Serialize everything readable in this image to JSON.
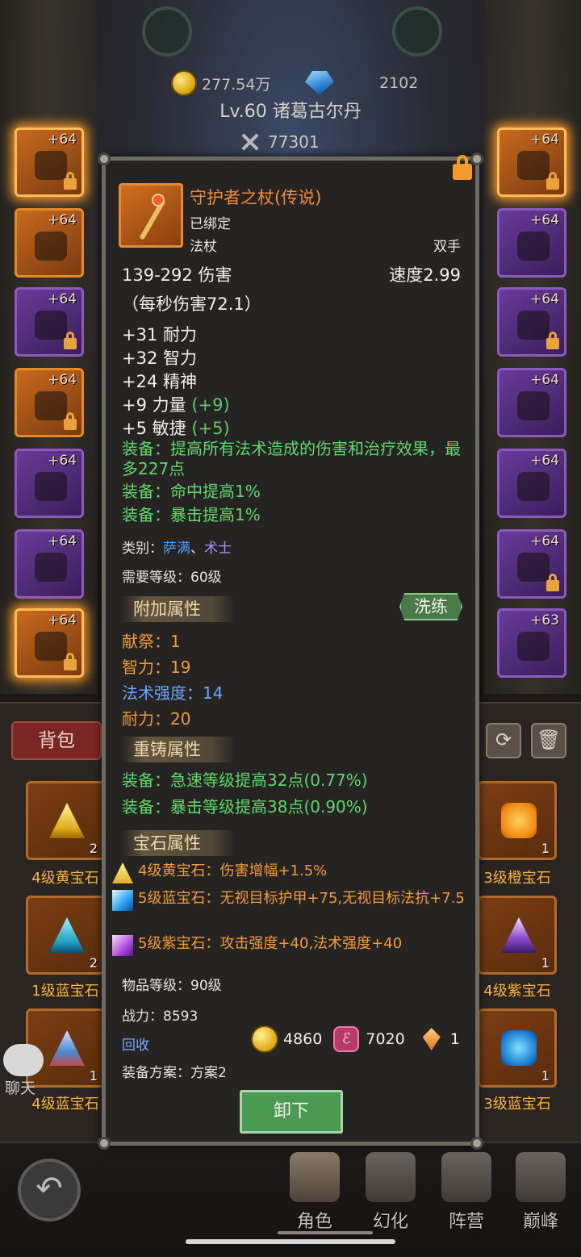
{
  "header": {
    "gold": "277.54万",
    "gems": "2102",
    "hero_name": "Lv.60 诸葛古尔丹",
    "combat_power": "77301"
  },
  "equip_slots": {
    "left": [
      {
        "level": "+64",
        "rarity": "orange",
        "glow": true,
        "locked": true,
        "icon": "helmet-icon"
      },
      {
        "level": "+64",
        "rarity": "orange",
        "glow": false,
        "locked": false,
        "icon": "necklace-icon"
      },
      {
        "level": "+64",
        "rarity": "purple",
        "glow": false,
        "locked": true,
        "icon": "shoulder-icon"
      },
      {
        "level": "+64",
        "rarity": "orange",
        "glow": false,
        "locked": true,
        "icon": "chest-armor-icon"
      },
      {
        "level": "+64",
        "rarity": "purple",
        "glow": false,
        "locked": false,
        "icon": "bracer-icon"
      },
      {
        "level": "+64",
        "rarity": "purple",
        "glow": false,
        "locked": false,
        "icon": "glove-icon"
      },
      {
        "level": "+64",
        "rarity": "orange",
        "glow": true,
        "locked": true,
        "icon": "boots-icon"
      }
    ],
    "right": [
      {
        "level": "+64",
        "rarity": "orange",
        "glow": true,
        "locked": true,
        "icon": "belt-icon"
      },
      {
        "level": "+64",
        "rarity": "purple",
        "glow": false,
        "locked": false,
        "icon": "pants-icon"
      },
      {
        "level": "+64",
        "rarity": "purple",
        "glow": false,
        "locked": true,
        "icon": "feet-icon"
      },
      {
        "level": "+64",
        "rarity": "purple",
        "glow": false,
        "locked": false,
        "icon": "ring-icon"
      },
      {
        "level": "+64",
        "rarity": "purple",
        "glow": false,
        "locked": false,
        "icon": "ring-icon"
      },
      {
        "level": "+64",
        "rarity": "purple",
        "glow": false,
        "locked": true,
        "icon": "trinket-icon"
      },
      {
        "level": "+63",
        "rarity": "purple",
        "glow": false,
        "locked": false,
        "icon": "trinket-icon"
      }
    ]
  },
  "bag": {
    "tab_label": "背包",
    "items_left": [
      {
        "label": "4级黄宝石",
        "count": "2",
        "gem": "yellow"
      },
      {
        "label": "1级蓝宝石",
        "count": "2",
        "gem": "blue"
      },
      {
        "label": "4级蓝宝石",
        "count": "1",
        "gem": "blue-multi"
      }
    ],
    "items_right": [
      {
        "label": "3级橙宝石",
        "count": "1",
        "gem": "orange"
      },
      {
        "label": "4级紫宝石",
        "count": "1",
        "gem": "purple"
      },
      {
        "label": "3级蓝宝石",
        "count": "1",
        "gem": "blue-square"
      }
    ]
  },
  "chat": {
    "label": "聊天"
  },
  "nav": [
    {
      "label": "角色",
      "active": true
    },
    {
      "label": "幻化",
      "active": false
    },
    {
      "label": "阵营",
      "active": false
    },
    {
      "label": "巅峰",
      "active": false
    }
  ],
  "tooltip": {
    "name": "守护者之杖(传说)",
    "bound": "已绑定",
    "type": "法杖",
    "hand": "双手",
    "damage": "139-292 伤害",
    "speed": "速度2.99",
    "dps": "（每秒伤害72.1）",
    "stats": [
      {
        "text": "+31 耐力",
        "bonus": ""
      },
      {
        "text": "+32 智力",
        "bonus": ""
      },
      {
        "text": "+24 精神",
        "bonus": ""
      },
      {
        "text": "+9 力量 ",
        "bonus": "(+9)"
      },
      {
        "text": "+5 敏捷 ",
        "bonus": "(+5)"
      }
    ],
    "equip_effects": [
      "装备：提高所有法术造成的伤害和治疗效果，最多227点",
      "装备：命中提高1%",
      "装备：暴击提高1%"
    ],
    "class_label": "类别：",
    "class_1": "萨满",
    "class_sep": "、",
    "class_2": "术士",
    "required_level": "需要等级：60级",
    "extra_header": "附加属性",
    "reroll_label": "洗练",
    "extra_stats": [
      {
        "text": "献祭：1",
        "color": "#f09a3a"
      },
      {
        "text": "智力：19",
        "color": "#f09a3a"
      },
      {
        "text": "法术强度：14",
        "color": "#6aa8ff"
      },
      {
        "text": "耐力：20",
        "color": "#f09a3a"
      }
    ],
    "reforge_header": "重铸属性",
    "reforge_stats": [
      "装备：急速等级提高32点(0.77%)",
      "装备：暴击等级提高38点(0.90%)"
    ],
    "gem_header": "宝石属性",
    "gems": [
      {
        "text": "4级黄宝石：伤害增幅+1.5%",
        "color": "yellow"
      },
      {
        "text": "5级蓝宝石：无视目标护甲+75,无视目标法抗+7.5",
        "color": "blue"
      },
      {
        "text": "5级紫宝石：攻击强度+40,法术强度+40",
        "color": "purple"
      }
    ],
    "item_level": "物品等级：90级",
    "power": "战力：8593",
    "recycle_label": "回收",
    "recycle_gold": "4860",
    "recycle_rune": "7020",
    "recycle_shard": "1",
    "scheme": "装备方案：方案2",
    "unequip_label": "卸下"
  }
}
